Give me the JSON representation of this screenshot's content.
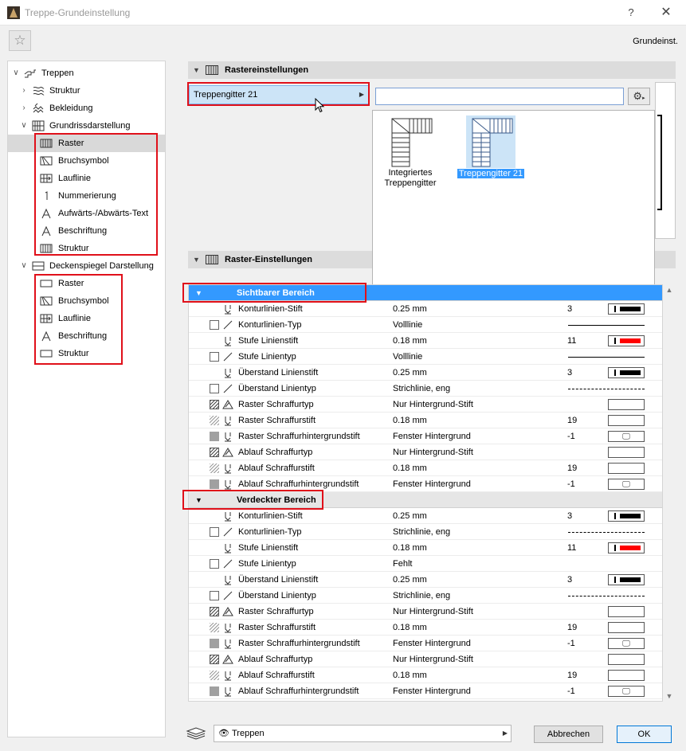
{
  "window": {
    "title": "Treppe-Grundeinstellung",
    "help": "?",
    "close": "✕",
    "preset": "Grundeinst."
  },
  "tree": [
    {
      "label": "Treppen",
      "level": 0,
      "chev": "∨",
      "icon": "stairs-icon"
    },
    {
      "label": "Struktur",
      "level": 1,
      "chev": "›",
      "icon": "structure-icon"
    },
    {
      "label": "Bekleidung",
      "level": 1,
      "chev": "›",
      "icon": "cladding-icon"
    },
    {
      "label": "Grundrissdarstellung",
      "level": 1,
      "chev": "∨",
      "icon": "floorplan-icon"
    },
    {
      "label": "Raster",
      "level": 2,
      "icon": "grid-icon",
      "selected": true
    },
    {
      "label": "Bruchsymbol",
      "level": 2,
      "icon": "break-icon"
    },
    {
      "label": "Lauflinie",
      "level": 2,
      "icon": "walkline-icon"
    },
    {
      "label": "Nummerierung",
      "level": 2,
      "icon": "numbering-icon"
    },
    {
      "label": "Aufwärts-/Abwärts-Text",
      "level": 2,
      "icon": "text-icon"
    },
    {
      "label": "Beschriftung",
      "level": 2,
      "icon": "label-icon"
    },
    {
      "label": "Struktur",
      "level": 2,
      "icon": "grid-icon"
    },
    {
      "label": "Deckenspiegel Darstellung",
      "level": 1,
      "chev": "∨",
      "icon": "ceiling-icon"
    },
    {
      "label": "Raster",
      "level": 2,
      "icon": "rect-icon"
    },
    {
      "label": "Bruchsymbol",
      "level": 2,
      "icon": "break-icon"
    },
    {
      "label": "Lauflinie",
      "level": 2,
      "icon": "walkline-icon"
    },
    {
      "label": "Beschriftung",
      "level": 2,
      "icon": "label-icon"
    },
    {
      "label": "Struktur",
      "level": 2,
      "icon": "rect-icon"
    }
  ],
  "section1": {
    "title": "Rastereinstellungen"
  },
  "section2": {
    "title": "Raster-Einstellungen"
  },
  "grid_select": {
    "value": "Treppengitter 21"
  },
  "search": {
    "placeholder": ""
  },
  "thumbs": [
    {
      "label1": "Integriertes",
      "label2": "Treppengitter"
    },
    {
      "label1": "Treppengitter 21"
    }
  ],
  "groups": [
    {
      "name": "Sichtbarer Bereich",
      "active": true,
      "rows": [
        {
          "check": "none",
          "icon": "pen",
          "name": "Konturlinien-Stift",
          "value": "0.25 mm",
          "num": "3",
          "swatch": "thick-black"
        },
        {
          "check": "box",
          "icon": "slash",
          "name": "Konturlinien-Typ",
          "value": "Volllinie",
          "line": "solid"
        },
        {
          "check": "none",
          "icon": "pen",
          "name": "Stufe Linienstift",
          "value": "0.18 mm",
          "num": "11",
          "swatch": "red"
        },
        {
          "check": "box",
          "icon": "slash",
          "name": "Stufe Linientyp",
          "value": "Volllinie",
          "line": "solid"
        },
        {
          "check": "none",
          "icon": "pen",
          "name": "Überstand Linienstift",
          "value": "0.25 mm",
          "num": "3",
          "swatch": "thick-black"
        },
        {
          "check": "box",
          "icon": "slash",
          "name": "Überstand Linientyp",
          "value": "Strichlinie, eng",
          "line": "dashed"
        },
        {
          "check": "hatch",
          "icon": "fill",
          "name": "Raster Schraffurtyp",
          "value": "Nur Hintergrund-Stift",
          "swatch": "empty"
        },
        {
          "check": "hatch2",
          "icon": "pen",
          "name": "Raster Schraffurstift",
          "value": "0.18 mm",
          "num": "19",
          "swatch": "empty"
        },
        {
          "check": "filled",
          "icon": "pen",
          "name": "Raster Schraffurhintergrundstift",
          "value": "Fenster Hintergrund",
          "num": "-1",
          "swatch": "monitor"
        },
        {
          "check": "hatch",
          "icon": "fill",
          "name": "Ablauf Schraffurtyp",
          "value": "Nur Hintergrund-Stift",
          "swatch": "empty"
        },
        {
          "check": "hatch2",
          "icon": "pen",
          "name": "Ablauf Schraffurstift",
          "value": "0.18 mm",
          "num": "19",
          "swatch": "empty"
        },
        {
          "check": "filled",
          "icon": "pen",
          "name": "Ablauf Schraffurhintergrundstift",
          "value": "Fenster Hintergrund",
          "num": "-1",
          "swatch": "monitor"
        }
      ]
    },
    {
      "name": "Verdeckter Bereich",
      "active": false,
      "rows": [
        {
          "check": "none",
          "icon": "pen",
          "name": "Konturlinien-Stift",
          "value": "0.25 mm",
          "num": "3",
          "swatch": "thick-black"
        },
        {
          "check": "box",
          "icon": "slash",
          "name": "Konturlinien-Typ",
          "value": "Strichlinie, eng",
          "line": "dashed"
        },
        {
          "check": "none",
          "icon": "pen",
          "name": "Stufe Linienstift",
          "value": "0.18 mm",
          "num": "11",
          "swatch": "red"
        },
        {
          "check": "box",
          "icon": "slash",
          "name": "Stufe Linientyp",
          "value": "Fehlt"
        },
        {
          "check": "none",
          "icon": "pen",
          "name": "Überstand Linienstift",
          "value": "0.25 mm",
          "num": "3",
          "swatch": "thick-black"
        },
        {
          "check": "box",
          "icon": "slash",
          "name": "Überstand Linientyp",
          "value": "Strichlinie, eng",
          "line": "dashed"
        },
        {
          "check": "hatch",
          "icon": "fill",
          "name": "Raster Schraffurtyp",
          "value": "Nur Hintergrund-Stift",
          "swatch": "empty"
        },
        {
          "check": "hatch2",
          "icon": "pen",
          "name": "Raster Schraffurstift",
          "value": "0.18 mm",
          "num": "19",
          "swatch": "empty"
        },
        {
          "check": "filled",
          "icon": "pen",
          "name": "Raster Schraffurhintergrundstift",
          "value": "Fenster Hintergrund",
          "num": "-1",
          "swatch": "monitor"
        },
        {
          "check": "hatch",
          "icon": "fill",
          "name": "Ablauf Schraffurtyp",
          "value": "Nur Hintergrund-Stift",
          "swatch": "empty"
        },
        {
          "check": "hatch2",
          "icon": "pen",
          "name": "Ablauf Schraffurstift",
          "value": "0.18 mm",
          "num": "19",
          "swatch": "empty"
        },
        {
          "check": "filled",
          "icon": "pen",
          "name": "Ablauf Schraffurhintergrundstift",
          "value": "Fenster Hintergrund",
          "num": "-1",
          "swatch": "monitor"
        }
      ]
    }
  ],
  "footer": {
    "layer": "Treppen",
    "cancel": "Abbrechen",
    "ok": "OK"
  },
  "colors": {
    "accent": "#3399ff",
    "highlight_box": "#e0101a",
    "pen_red": "#ff0000"
  }
}
